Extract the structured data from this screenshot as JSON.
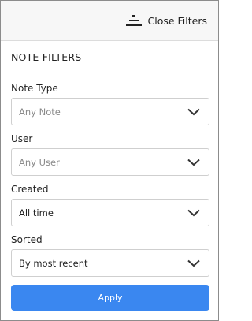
{
  "header": {
    "close_label": "Close Filters",
    "icon": "filter-lines-icon"
  },
  "title": "NOTE FILTERS",
  "filters": [
    {
      "label": "Note Type",
      "value": "Any Note",
      "placeholder": true
    },
    {
      "label": "User",
      "value": "Any User",
      "placeholder": true
    },
    {
      "label": "Created",
      "value": "All time",
      "placeholder": false
    },
    {
      "label": "Sorted",
      "value": "By most recent",
      "placeholder": false
    }
  ],
  "apply_label": "Apply",
  "colors": {
    "accent": "#3a87f0",
    "header_bg": "#f7f7f7",
    "border": "#cfcfcf"
  }
}
